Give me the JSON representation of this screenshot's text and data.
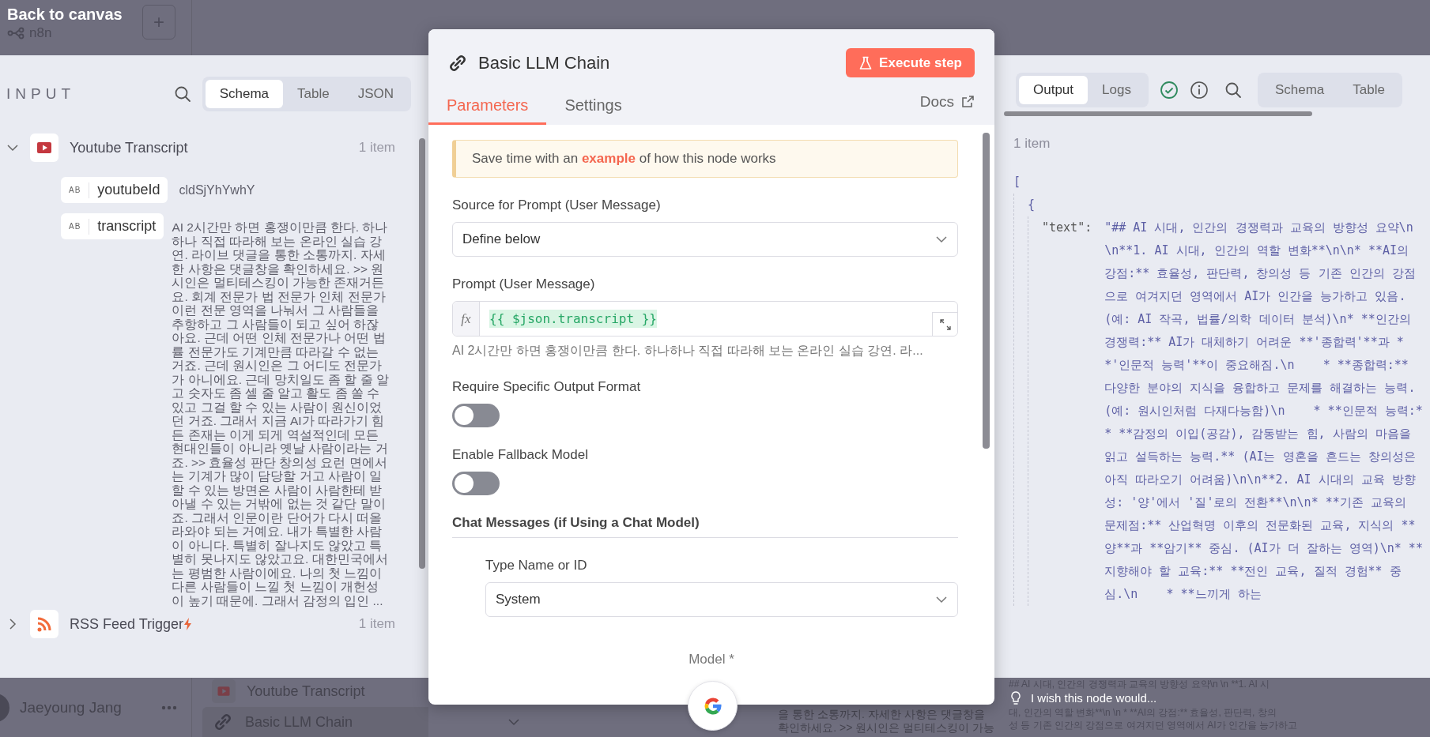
{
  "top_bar": {
    "back_link": "Back to canvas",
    "logo_text": "n8n",
    "add_button": "+"
  },
  "input_panel": {
    "title": "INPUT",
    "view_tabs": [
      {
        "label": "Schema",
        "selected": true
      },
      {
        "label": "Table",
        "selected": false
      },
      {
        "label": "JSON",
        "selected": false
      }
    ],
    "nodes": [
      {
        "kind": "video",
        "name": "Youtube Transcript",
        "count": "1 item",
        "expanded": true,
        "trigger": false,
        "fields": [
          {
            "type_badge": "AB",
            "name": "youtubeId",
            "value": "cldSjYhYwhY"
          },
          {
            "type_badge": "AB",
            "name": "transcript",
            "value": "AI 2시간만 하면 홍쟁이만큼 한다. 하나하나 직접 따라해 보는 온라인 실습 강연. 라이브 댓글을 통한 소통까지. 자세한 사항은 댓글창을 확인하세요. >> 원시인은 멀티테스킹이 가능한 존재거든요. 회계 전문가 법 전문가 인체 전문가 이런 전문 영역을 나눠서 그 사람들을 추항하고 그 사람들이 되고 싶어 하잖아요. 근데 어떤 인체 전문가나 어떤 법률 전문가도 기계만큼 따라갈 수 없는 거죠. 근데 원시인은 그 어디도 전문가가 아니에요. 근데 망치일도 좀 할 줄 알고 숫자도 좀 셀 줄 알고 활도 좀 쏠 수 있고 그걸 할 수 있는 사람이 원신이었던 거죠. 그래서 지금 AI가 따라가기 힘든 존재는 이게 되게 역설적인데 모든 현대인들이 아니라 옛날 사람이라는 거죠. >> 효율성 판단 창의성 요런 면에서는 기계가 많이 담당할 거고 사람이 일할 수 있는 방면은 사람이 사람한테 받아낼 수 있는 거밖에 없는 것 같단 말이죠. 그래서 인문이란 단어가 다시 떠올라와야 되는 거예요. 내가 특별한 사람이 아니다. 특별히 잘나지도 않았고 특별히 못나지도 않았고요. 대한민국에서는 평범한 사람이에요. 나의 첫 느낌이 다른 사람들이 느낄 첫 느낌이 개헌성이 높기 때문에. 그래서 감정의 입인 ..."
          }
        ]
      },
      {
        "kind": "feed",
        "name": "RSS Feed Trigger",
        "count": "1 item",
        "expanded": false,
        "trigger": true
      }
    ]
  },
  "modal": {
    "title": "Basic LLM Chain",
    "execute_button": "Execute step",
    "tabs": [
      {
        "label": "Parameters",
        "selected": true
      },
      {
        "label": "Settings",
        "selected": false
      }
    ],
    "docs_link": "Docs",
    "callout": {
      "before": "Save time with an ",
      "link": "example",
      "after": " of how this node works"
    },
    "parameters": [
      {
        "kind": "select",
        "label": "Source for Prompt (User Message)",
        "value": "Define below"
      },
      {
        "kind": "expression",
        "label": "Prompt (User Message)",
        "prefix": "fx",
        "value": "{{ $json.transcript }}",
        "preview": "AI 2시간만 하면 홍쟁이만큼 한다. 하나하나 직접 따라해 보는 온라인 실습 강연. 라..."
      },
      {
        "kind": "toggle",
        "label": "Require Specific Output Format",
        "on": false
      },
      {
        "kind": "toggle",
        "label": "Enable Fallback Model",
        "on": false
      },
      {
        "kind": "section",
        "label": "Chat Messages (if Using a Chat Model)",
        "children": [
          {
            "kind": "select",
            "label": "Type Name or ID",
            "value": "System"
          }
        ]
      }
    ],
    "model_label": "Model *"
  },
  "output_panel": {
    "tabs": [
      {
        "label": "Output",
        "selected": true
      },
      {
        "label": "Logs",
        "selected": false
      }
    ],
    "view_tabs": [
      {
        "label": "Schema",
        "selected": false
      },
      {
        "label": "Table",
        "selected": false
      }
    ],
    "count": "1 item",
    "array_open": "[",
    "object_open": "{",
    "key": "\"text\":",
    "value": "\"## AI 시대, 인간의 경쟁력과 교육의 방향성 요약\\n\\n**1. AI 시대, 인간의 역할 변화**\\n\\n* **AI의 강점:** 효율성, 판단력, 창의성 등 기존 인간의 강점으로 여겨지던 영역에서 AI가 인간을 능가하고 있음. (예: AI 작곡, 법률/의학 데이터 분석)\\n* **인간의 경쟁력:** AI가 대체하기 어려운 **'종합력'**과 **'인문적 능력'**이 중요해짐.\\n    * **종합력:** 다양한 분야의 지식을 융합하고 문제를 해결하는 능력. (예: 원시인처럼 다재다능함)\\n    * **인문적 능력:** **감정의 이입(공감), 감동받는 힘, 사람의 마음을 읽고 설득하는 능력.** (AI는 영혼을 흔드는 창의성은 아직 따라오기 어려움)\\n\\n**2. AI 시대의 교육 방향성: '양'에서 '질'로의 전환**\\n\\n* **기존 교육의 문제점:** 산업혁명 이후의 전문화된 교육, 지식의 **양**과 **암기** 중심. (AI가 더 잘하는 영역)\\n* **지향해야 할 교육:** **전인 교육, 질적 경험** 중심.\\n    * **느끼게 하는"
  },
  "bottom_bar": {
    "user_name": "Jaeyoung Jang",
    "canvas_nodes": [
      {
        "kind": "video",
        "name": "Youtube Transcript"
      },
      {
        "kind": "chain",
        "name": "Basic LLM Chain"
      }
    ],
    "canvas_preview": [
      "을 통한 소통까지. 자세한 사항은 댓글창을",
      "확인하세요. >> 원시인은 멀티테스킹이 가능"
    ],
    "output_preview_top": "## AI 시대, 인간의 경쟁력과 교육의 방향성 요약\\n \\n **1. AI 시",
    "feedback_prompt": "I wish this node would...",
    "output_preview": [
      "대, 인간의 역할 변화**\\n \\n * **AI의 강점:** 효율성, 판단력, 창의",
      "성 등 기존 인간의 강점으로 여겨지던 영역에서 AI가 인간을 능가하고"
    ]
  }
}
